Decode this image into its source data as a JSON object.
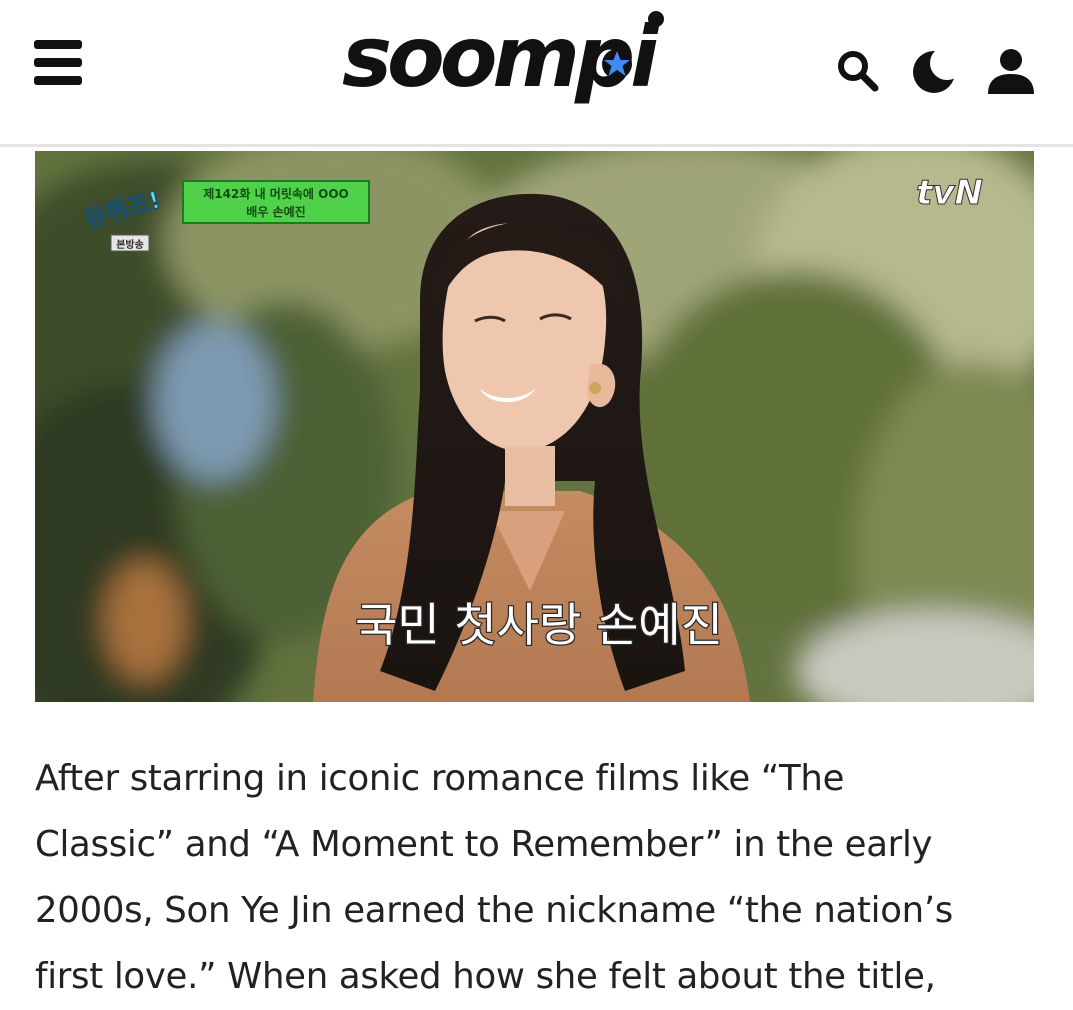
{
  "header": {
    "menu_icon": "hamburger-menu-icon",
    "logo_text": "soompi",
    "search_icon": "search-icon",
    "theme_icon": "moon-icon",
    "account_icon": "user-icon"
  },
  "hero": {
    "show_logo": "유퀴즈!",
    "episode_line1": "제142화 내 머릿속에 OOO",
    "episode_line2": "배우 손예진",
    "rerun_tag": "본방송",
    "channel": "tvN",
    "subtitle": "국민 첫사랑 손예진"
  },
  "article": {
    "line1": "After starring in iconic romance films like “The",
    "line2": "Classic” and “A Moment to Remember” in the early",
    "line3": "2000s, Son Ye Jin earned the nickname “the nation’s",
    "line4": "first love.” When asked how she felt about the title,"
  },
  "colors": {
    "text": "#222222",
    "logo": "#111111",
    "logo_star_blue": "#3d8bf5",
    "divider": "#e4e4e4",
    "badge_green": "#4fd14a"
  }
}
